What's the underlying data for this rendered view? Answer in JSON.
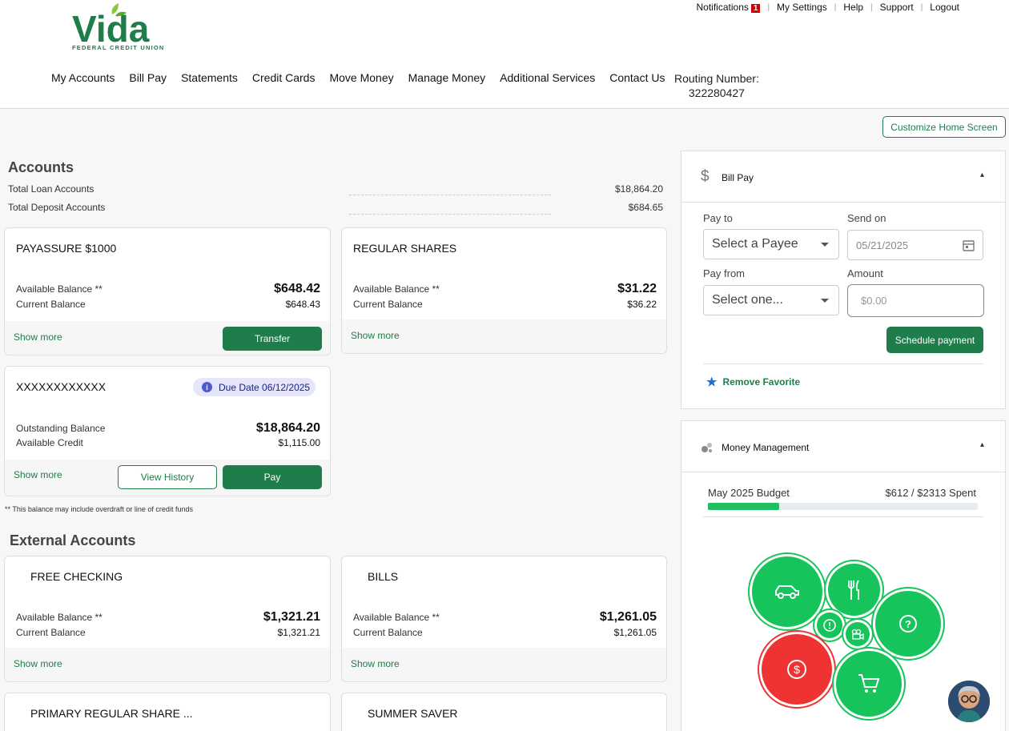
{
  "brand": {
    "name": "Vida",
    "subtitle": "FEDERAL CREDIT UNION",
    "primary": "#1e7d4b",
    "accent": "#8ec63f"
  },
  "util_nav": {
    "notifications": "Notifications",
    "notif_count": "1",
    "settings": "My Settings",
    "help": "Help",
    "support": "Support",
    "logout": "Logout"
  },
  "main_nav": [
    "My Accounts",
    "Bill Pay",
    "Statements",
    "Credit Cards",
    "Move Money",
    "Manage Money",
    "Additional Services",
    "Contact Us"
  ],
  "routing": {
    "label": "Routing Number:",
    "value": "322280427"
  },
  "customize_label": "Customize Home Screen",
  "accounts": {
    "title": "Accounts",
    "loan_label": "Total Loan Accounts",
    "loan_value": "$18,864.20",
    "deposit_label": "Total Deposit Accounts",
    "deposit_value": "$684.65",
    "cards": [
      {
        "name": "PAYASSURE $1000",
        "l1": "Available Balance **",
        "v1": "$648.42",
        "l2": "Current Balance",
        "v2": "$648.43",
        "more": "Show more",
        "btn": "Transfer"
      },
      {
        "name": "REGULAR SHARES",
        "l1": "Available Balance **",
        "v1": "$31.22",
        "l2": "Current Balance",
        "v2": "$36.22",
        "more": "Show more"
      },
      {
        "name": "XXXXXXXXXXXX",
        "due": "Due Date 06/12/2025",
        "l1": "Outstanding Balance",
        "v1": "$18,864.20",
        "l2": "Available Credit",
        "v2": "$1,115.00",
        "more": "Show more",
        "btn_history": "View History",
        "btn_pay": "Pay"
      }
    ],
    "note": "** This balance may include overdraft or line of credit funds"
  },
  "external": {
    "title": "External Accounts",
    "cards": [
      {
        "name": "FREE CHECKING",
        "l1": "Available Balance **",
        "v1": "$1,321.21",
        "l2": "Current Balance",
        "v2": "$1,321.21",
        "more": "Show more"
      },
      {
        "name": "BILLS",
        "l1": "Available Balance **",
        "v1": "$1,261.05",
        "l2": "Current Balance",
        "v2": "$1,261.05",
        "more": "Show more"
      },
      {
        "name": "PRIMARY REGULAR SHARE ..."
      },
      {
        "name": "SUMMER SAVER"
      }
    ]
  },
  "billpay": {
    "title": "Bill Pay",
    "pay_to": "Pay to",
    "payee_placeholder": "Select a Payee",
    "send_on": "Send on",
    "date": "05/21/2025",
    "pay_from": "Pay from",
    "from_placeholder": "Select one...",
    "amount": "Amount",
    "amount_placeholder": "$0.00",
    "schedule": "Schedule payment",
    "favorite": "Remove Favorite"
  },
  "money": {
    "title": "Money Management",
    "budget_label": "May 2025 Budget",
    "budget_value": "$612 / $2313 Spent",
    "spent": 612,
    "total": 2313,
    "categories": [
      "car-icon",
      "dining-icon",
      "help-icon",
      "alert-icon",
      "entertainment-icon",
      "dollar-icon",
      "shopping-cart-icon"
    ]
  }
}
